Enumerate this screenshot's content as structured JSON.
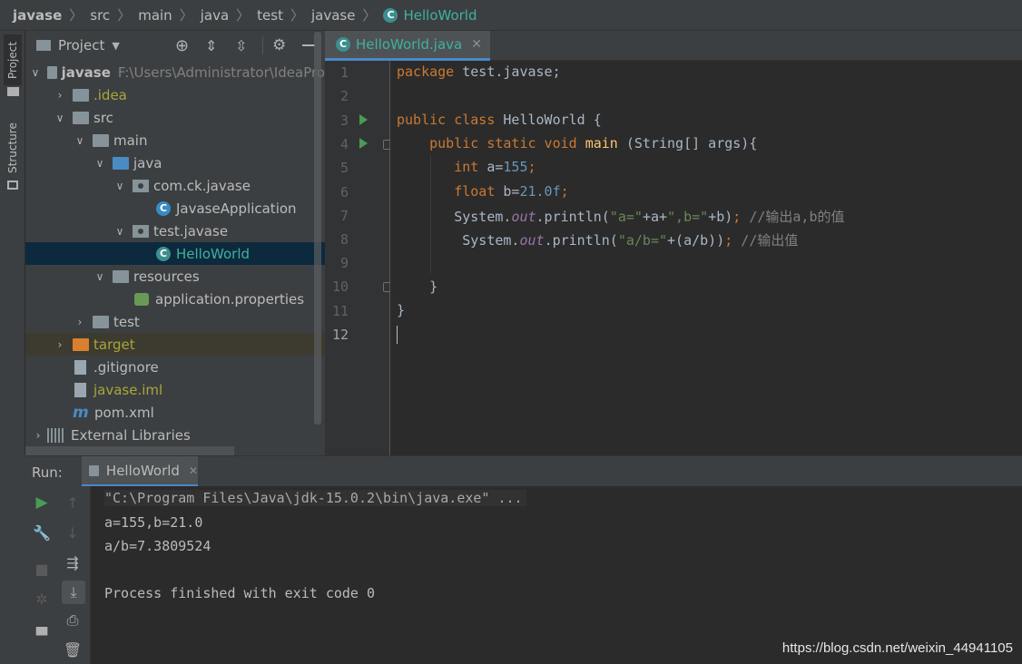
{
  "breadcrumb": [
    "javase",
    "src",
    "main",
    "java",
    "test",
    "javase",
    "HelloWorld"
  ],
  "left_strip": {
    "project_tab": "Project",
    "structure_tab": "Structure"
  },
  "project_panel": {
    "title": "Project",
    "tree": [
      {
        "label": "javase",
        "path_hint": "F:\\Users\\Administrator\\IdeaPro"
      },
      {
        "label": ".idea"
      },
      {
        "label": "src"
      },
      {
        "label": "main"
      },
      {
        "label": "java"
      },
      {
        "label": "com.ck.javase"
      },
      {
        "label": "JavaseApplication"
      },
      {
        "label": "test.javase"
      },
      {
        "label": "HelloWorld"
      },
      {
        "label": "resources"
      },
      {
        "label": "application.properties"
      },
      {
        "label": "test"
      },
      {
        "label": "target"
      },
      {
        "label": ".gitignore"
      },
      {
        "label": "javase.iml"
      },
      {
        "label": "pom.xml"
      },
      {
        "label": "External Libraries"
      }
    ]
  },
  "editor": {
    "tab_label": "HelloWorld.java",
    "line_numbers": [
      "1",
      "2",
      "3",
      "4",
      "5",
      "6",
      "7",
      "8",
      "9",
      "10",
      "11",
      "12"
    ],
    "code": {
      "l1_kw": "package",
      "l1_rest": " test.javase;",
      "l3_kw": "public class",
      "l3_rest": " HelloWorld {",
      "l4_indent": "    ",
      "l4_kw": "public static void",
      "l4_sp": " ",
      "l4_fn": "main",
      "l4_rest": " (String[] args){",
      "l5_indent": "       ",
      "l5_kw": "int",
      "l5_mid": " a=",
      "l5_num": "155",
      "l5_end": ";",
      "l6_indent": "       ",
      "l6_kw": "float",
      "l6_mid": " b=",
      "l6_num": "21.0f",
      "l6_end": ";",
      "l7_a": "       System.",
      "l7_fld": "out",
      "l7_b": ".println(",
      "l7_s1": "\"a=\"",
      "l7_c": "+a+",
      "l7_s2": "\",b=\"",
      "l7_d": "+b)",
      "l7_semi": ";",
      "l7_cmt": " //输出a,b的值",
      "l8_a": "        System.",
      "l8_fld": "out",
      "l8_b": ".println(",
      "l8_s1": "\"a/b=\"",
      "l8_c": "+(a/b))",
      "l8_semi": ";",
      "l8_cmt": " //输出值",
      "l10": "    }",
      "l11": "}"
    }
  },
  "run_panel": {
    "run_label": "Run:",
    "tab_label": "HelloWorld",
    "console": [
      "\"C:\\Program Files\\Java\\jdk-15.0.2\\bin\\java.exe\" ...",
      "a=155,b=21.0",
      "a/b=7.3809524",
      "",
      "Process finished with exit code 0"
    ]
  },
  "watermark": "https://blog.csdn.net/weixin_44941105",
  "colors": {
    "accent": "#4a88c7",
    "keyword": "#cc7832",
    "number": "#6897bb",
    "string": "#6a8759",
    "run_green": "#499c54"
  }
}
